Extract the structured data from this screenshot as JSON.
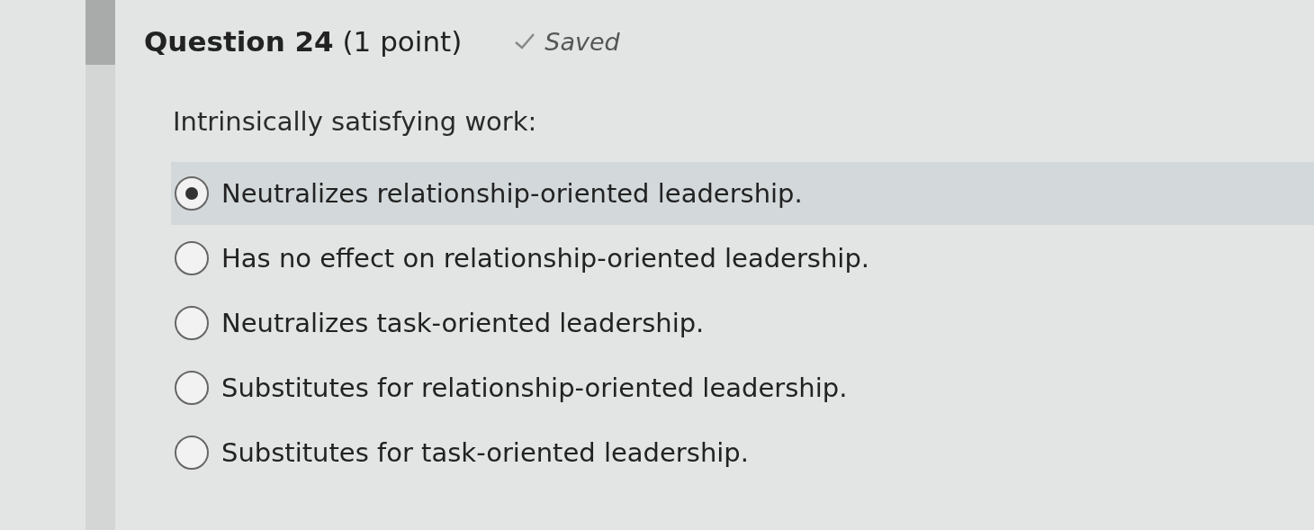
{
  "question": {
    "title": "**Question 24** (1 point)",
    "status": {
      "text": "Saved",
      "saved": true
    },
    "prompt": "Intrinsically satisfying work:"
  },
  "options": [
    {
      "label": "Neutralizes relationship-oriented leadership.",
      "selected": true
    },
    {
      "label": "Has no effect on relationship-oriented leadership.",
      "selected": false
    },
    {
      "label": "Neutralizes task-oriented leadership.",
      "selected": false
    },
    {
      "label": "Substitutes for relationship-oriented leadership.",
      "selected": false
    },
    {
      "label": "Substitutes for task-oriented leadership.",
      "selected": false
    }
  ]
}
